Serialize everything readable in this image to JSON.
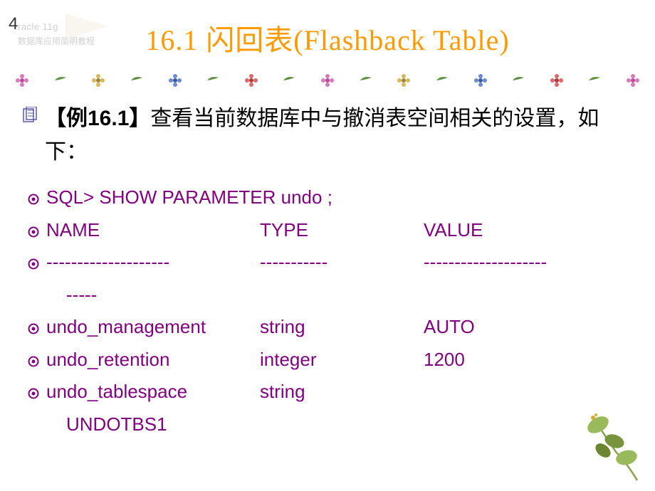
{
  "page_number": "4",
  "watermark": {
    "line1": "racle 11g",
    "line2": "数据库应用简明教程"
  },
  "title": "16.1  闪回表(Flashback Table)",
  "intro_prefix": "【例16.1】",
  "intro_rest": "查看当前数据库中与撤消表空间相关的设置，如下：",
  "sql": {
    "command": "SQL> SHOW PARAMETER undo ;",
    "headers": {
      "c1": "NAME",
      "c2": "TYPE",
      "c3": "VALUE"
    },
    "dashes": {
      "c1a": "--------------------",
      "c1b": "-----",
      "c2": "-----------",
      "c3": "--------------------"
    },
    "rows": [
      {
        "c1": "undo_management",
        "c2": "string",
        "c3": "AUTO"
      },
      {
        "c1": "undo_retention",
        "c2": "integer",
        "c3": "1200"
      }
    ],
    "wrap_row": {
      "c1": "undo_tablespace",
      "c2": "string",
      "wrap_value": "UNDOTBS1"
    }
  }
}
